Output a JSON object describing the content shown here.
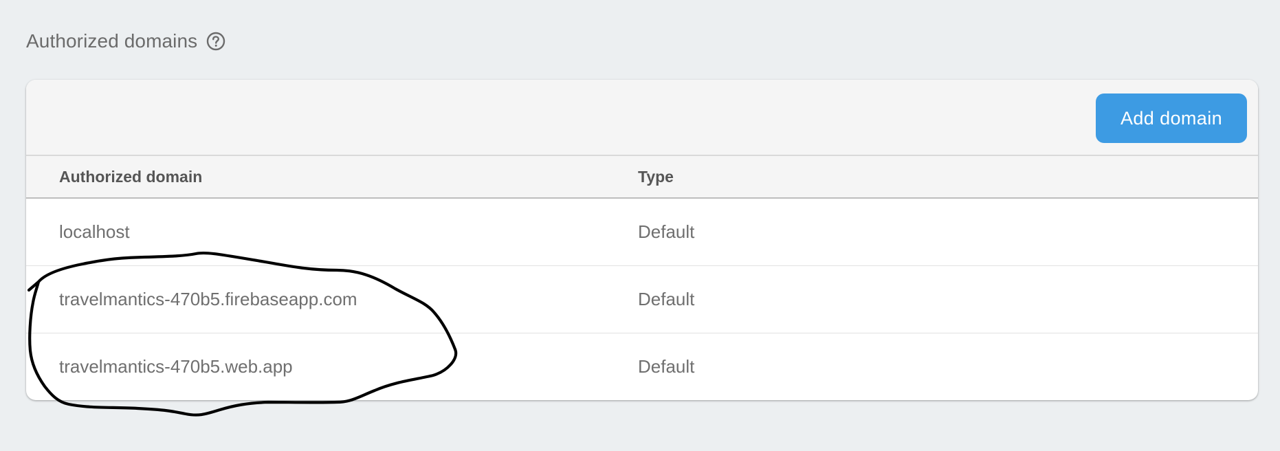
{
  "section": {
    "title": "Authorized domains",
    "help_icon": "help-circle-icon"
  },
  "toolbar": {
    "add_domain_label": "Add domain"
  },
  "table": {
    "columns": [
      "Authorized domain",
      "Type"
    ],
    "rows": [
      {
        "domain": "localhost",
        "type": "Default"
      },
      {
        "domain": "travelmantics-470b5.firebaseapp.com",
        "type": "Default"
      },
      {
        "domain": "travelmantics-470b5.web.app",
        "type": "Default"
      }
    ]
  },
  "colors": {
    "page_background": "#eceff1",
    "accent": "#3d9be3",
    "annotation_stroke": "#000000"
  }
}
